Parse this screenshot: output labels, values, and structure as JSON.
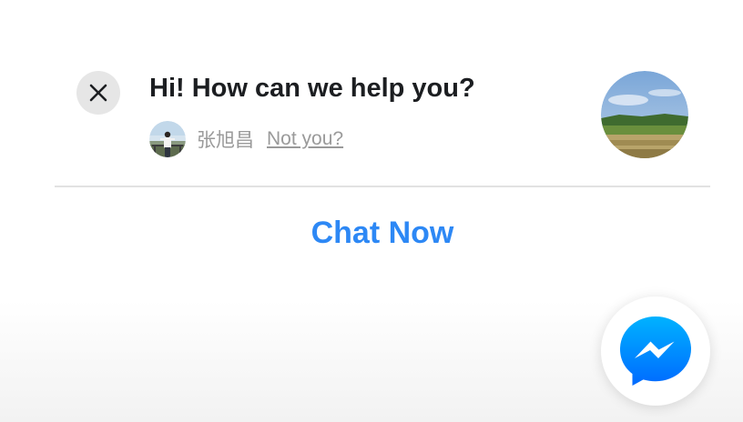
{
  "prompt": {
    "greeting": "Hi! How can we help you?",
    "user_name": "张旭昌",
    "not_you_label": "Not you?",
    "chat_now_label": "Chat Now"
  },
  "icons": {
    "close": "close-icon",
    "messenger": "messenger-icon"
  },
  "colors": {
    "accent": "#2d88f5",
    "messenger_gradient_top": "#00b2ff",
    "messenger_gradient_bottom": "#006aff",
    "close_bg": "#e6e6e6",
    "secondary_text": "#9a9a9a",
    "primary_text": "#1c1e21"
  }
}
